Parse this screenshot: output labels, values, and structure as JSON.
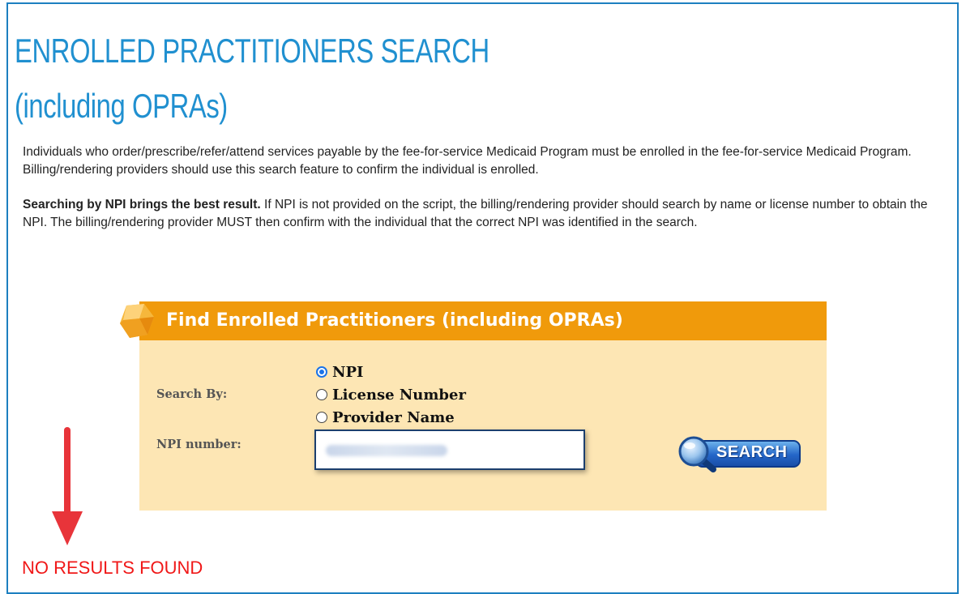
{
  "page": {
    "title_line1": "ENROLLED PRACTITIONERS SEARCH",
    "title_line2": "(including OPRAs)",
    "intro": "Individuals who order/prescribe/refer/attend services payable by the fee-for-service Medicaid Program must be enrolled in the fee-for-service Medicaid Program. Billing/rendering providers should use this search feature to confirm the individual is enrolled.",
    "tip_bold": "Searching by NPI brings the best result.",
    "tip_rest": " If NPI is not provided on the script, the billing/rendering provider should search by name or license number to obtain the NPI. The billing/rendering provider MUST then confirm with the individual that the correct NPI was identified in the search."
  },
  "search_panel": {
    "title": "Find Enrolled Practitioners (including OPRAs)",
    "search_by_label": "Search By:",
    "options": [
      {
        "label": "NPI",
        "checked": true
      },
      {
        "label": "License Number",
        "checked": false
      },
      {
        "label": "Provider Name",
        "checked": false
      }
    ],
    "npi_label": "NPI number:",
    "button_label": "SEARCH"
  },
  "result": {
    "message": "NO RESULTS FOUND"
  },
  "colors": {
    "accent_blue": "#2090d0",
    "panel_header": "#f09a0b",
    "panel_body": "#fde6b4",
    "error_red": "#f01818"
  },
  "icons": [
    "gem-icon",
    "magnifier-icon",
    "down-arrow-icon"
  ]
}
